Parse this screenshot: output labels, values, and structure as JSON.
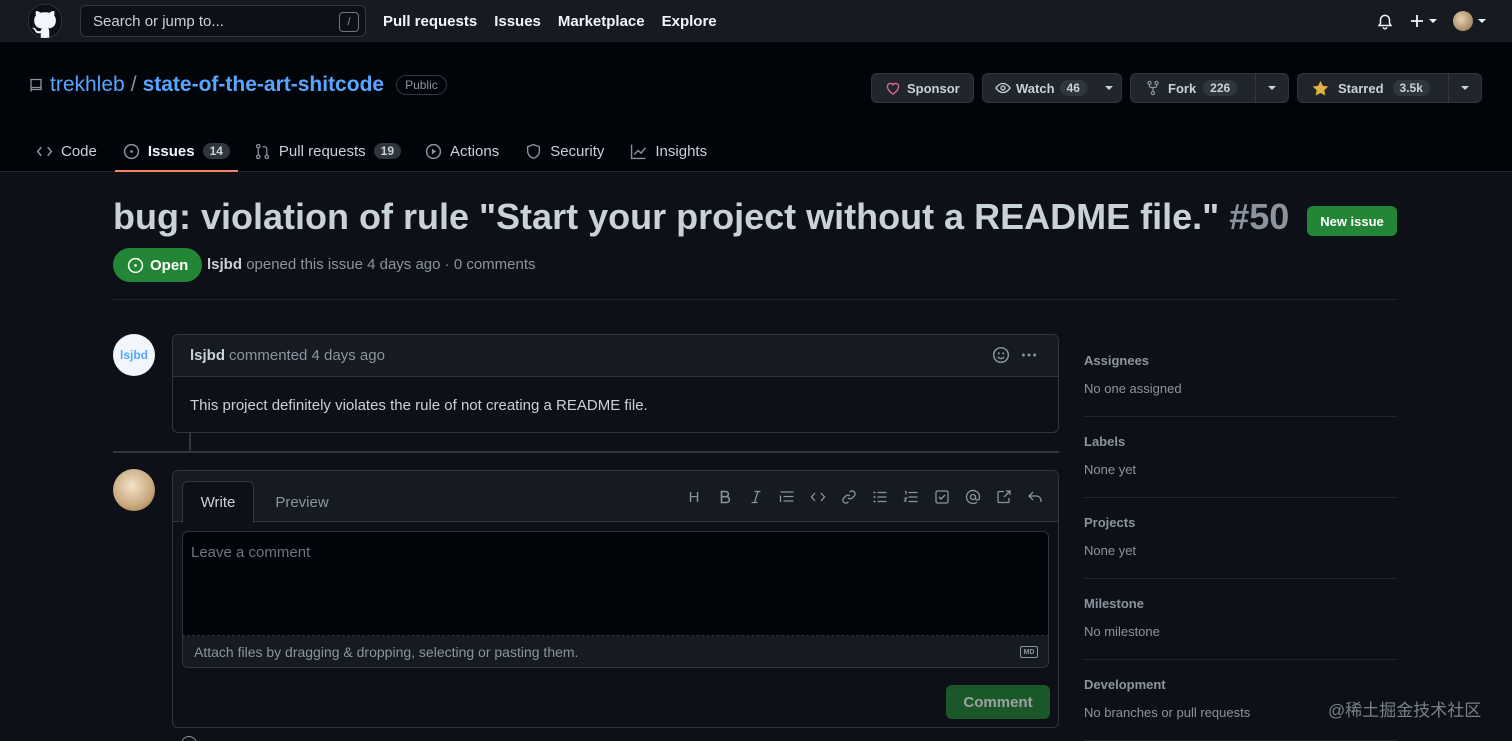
{
  "header": {
    "search_placeholder": "Search or jump to...",
    "search_shortcut": "/",
    "nav": [
      "Pull requests",
      "Issues",
      "Marketplace",
      "Explore"
    ]
  },
  "repo": {
    "owner": "trekhleb",
    "separator": "/",
    "name": "state-of-the-art-shitcode",
    "visibility": "Public",
    "sponsor_label": "Sponsor",
    "watch_label": "Watch",
    "watch_count": "46",
    "fork_label": "Fork",
    "fork_count": "226",
    "starred_label": "Starred",
    "star_count": "3.5k",
    "tabs": [
      {
        "label": "Code"
      },
      {
        "label": "Issues",
        "count": "14"
      },
      {
        "label": "Pull requests",
        "count": "19"
      },
      {
        "label": "Actions"
      },
      {
        "label": "Security"
      },
      {
        "label": "Insights"
      }
    ]
  },
  "issue": {
    "title": "bug: violation of rule \"Start your project without a README file.\"",
    "number": "#50",
    "new_issue_label": "New issue",
    "state": "Open",
    "author": "lsjbd",
    "meta_rest": "opened this issue 4 days ago · 0 comments"
  },
  "comment": {
    "avatar_text": "lsjbd",
    "author": "lsjbd",
    "action": "commented 4 days ago",
    "body": "This project definitely violates the rule of not creating a README file."
  },
  "form": {
    "tab_write": "Write",
    "tab_preview": "Preview",
    "heading_tool": "H",
    "placeholder": "Leave a comment",
    "attach_text": "Attach files by dragging & dropping, selecting or pasting them.",
    "md_badge": "MD",
    "submit_label": "Comment"
  },
  "sidebar": {
    "sections": [
      {
        "title": "Assignees",
        "value": "No one assigned"
      },
      {
        "title": "Labels",
        "value": "None yet"
      },
      {
        "title": "Projects",
        "value": "None yet"
      },
      {
        "title": "Milestone",
        "value": "No milestone"
      },
      {
        "title": "Development",
        "value": "No branches or pull requests"
      }
    ]
  },
  "watermark": "@稀土掘金技术社区",
  "colors": {
    "accent_green": "#238636",
    "link_blue": "#58a6ff",
    "active_tab_underline": "#f78166",
    "star_yellow": "#e3b341",
    "sponsor_pink": "#db61a2"
  }
}
